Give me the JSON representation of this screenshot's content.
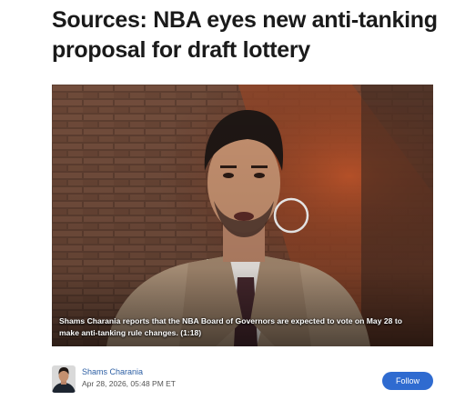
{
  "article": {
    "headline": "Sources: NBA eyes new anti-tanking proposal for draft lottery"
  },
  "video": {
    "caption": "Shams Charania reports that the NBA Board of Governors are expected to vote on May 28 to make anti-tanking rule changes. (1:18)"
  },
  "byline": {
    "author": "Shams Charania",
    "date": "Apr 28, 2026, 05:48 PM ET",
    "follow_label": "Follow"
  },
  "colors": {
    "follow_button": "#2f6bd0",
    "author_link": "#2c5ea3",
    "headline": "#1a1a1a"
  }
}
